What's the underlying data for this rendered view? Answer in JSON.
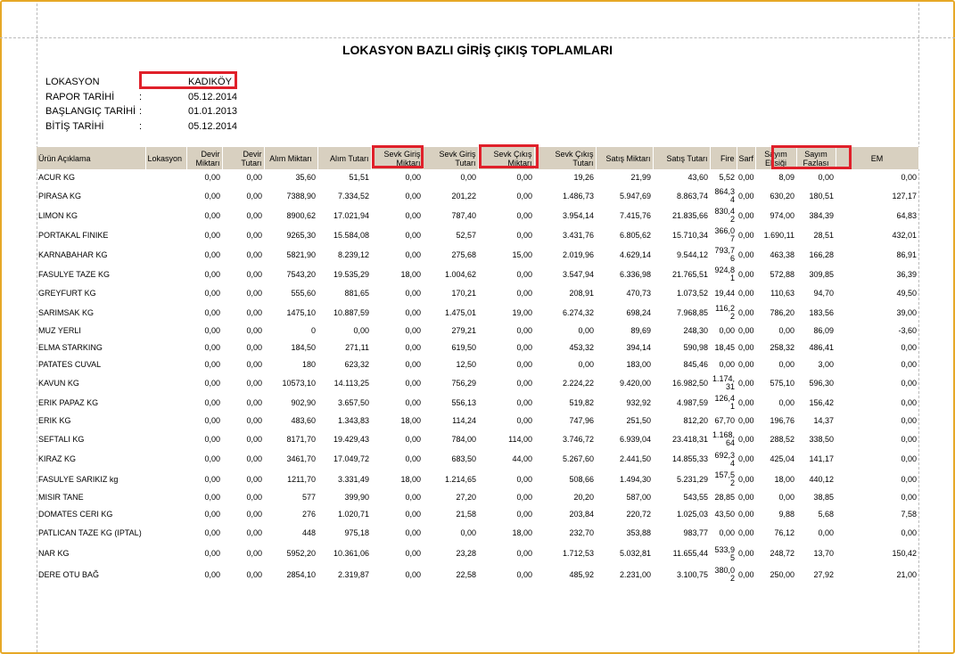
{
  "report": {
    "title": "LOKASYON BAZLI GİRİŞ ÇIKIŞ TOPLAMLARI",
    "meta": [
      {
        "label": "LOKASYON",
        "value": "KADIKÖY"
      },
      {
        "label": "RAPOR TARİHİ",
        "value": "05.12.2014"
      },
      {
        "label": "BAŞLANGIÇ TARİHİ",
        "value": "01.01.2013"
      },
      {
        "label": "BİTİŞ TARİHİ",
        "value": "05.12.2014"
      }
    ]
  },
  "table": {
    "headers": [
      "Ürün Açıklama",
      "Lokasyon",
      "Devir Miktarı",
      "Devir Tutarı",
      "Alım Miktarı",
      "Alım Tutarı",
      "Sevk Giriş Miktarı",
      "Sevk Giriş Tutarı",
      "Sevk Çıkış Miktarı",
      "Sevk Çıkış Tutarı",
      "Satış Miktarı",
      "Satış Tutarı",
      "Fire",
      "Sarf",
      "Sayım Eksiği",
      "Sayım Fazlası",
      "EM"
    ],
    "rows": [
      [
        "ACUR KG",
        "",
        "0,00",
        "0,00",
        "35,60",
        "51,51",
        "0,00",
        "0,00",
        "0,00",
        "19,26",
        "21,99",
        "43,60",
        "5,52",
        "0,00",
        "8,09",
        "0,00",
        "0,00"
      ],
      [
        "PIRASA KG",
        "",
        "0,00",
        "0,00",
        "7388,90",
        "7.334,52",
        "0,00",
        "201,22",
        "0,00",
        "1.486,73",
        "5.947,69",
        "8.863,74",
        "864,34",
        "0,00",
        "630,20",
        "180,51",
        "127,17"
      ],
      [
        "LIMON KG",
        "",
        "0,00",
        "0,00",
        "8900,62",
        "17.021,94",
        "0,00",
        "787,40",
        "0,00",
        "3.954,14",
        "7.415,76",
        "21.835,66",
        "830,42",
        "0,00",
        "974,00",
        "384,39",
        "64,83"
      ],
      [
        "PORTAKAL FINIKE",
        "",
        "0,00",
        "0,00",
        "9265,30",
        "15.584,08",
        "0,00",
        "52,57",
        "0,00",
        "3.431,76",
        "6.805,62",
        "15.710,34",
        "366,07",
        "0,00",
        "1.690,11",
        "28,51",
        "432,01"
      ],
      [
        "KARNABAHAR KG",
        "",
        "0,00",
        "0,00",
        "5821,90",
        "8.239,12",
        "0,00",
        "275,68",
        "15,00",
        "2.019,96",
        "4.629,14",
        "9.544,12",
        "793,76",
        "0,00",
        "463,38",
        "166,28",
        "86,91"
      ],
      [
        "FASULYE TAZE KG",
        "",
        "0,00",
        "0,00",
        "7543,20",
        "19.535,29",
        "18,00",
        "1.004,62",
        "0,00",
        "3.547,94",
        "6.336,98",
        "21.765,51",
        "924,81",
        "0,00",
        "572,88",
        "309,85",
        "36,39"
      ],
      [
        "GREYFURT KG",
        "",
        "0,00",
        "0,00",
        "555,60",
        "881,65",
        "0,00",
        "170,21",
        "0,00",
        "208,91",
        "470,73",
        "1.073,52",
        "19,44",
        "0,00",
        "110,63",
        "94,70",
        "49,50"
      ],
      [
        "SARIMSAK KG",
        "",
        "0,00",
        "0,00",
        "1475,10",
        "10.887,59",
        "0,00",
        "1.475,01",
        "19,00",
        "6.274,32",
        "698,24",
        "7.968,85",
        "116,22",
        "0,00",
        "786,20",
        "183,56",
        "39,00"
      ],
      [
        "MUZ YERLI",
        "",
        "0,00",
        "0,00",
        "0",
        "0,00",
        "0,00",
        "279,21",
        "0,00",
        "0,00",
        "89,69",
        "248,30",
        "0,00",
        "0,00",
        "0,00",
        "86,09",
        "-3,60"
      ],
      [
        "ELMA STARKING",
        "",
        "0,00",
        "0,00",
        "184,50",
        "271,11",
        "0,00",
        "619,50",
        "0,00",
        "453,32",
        "394,14",
        "590,98",
        "18,45",
        "0,00",
        "258,32",
        "486,41",
        "0,00"
      ],
      [
        "PATATES CUVAL",
        "",
        "0,00",
        "0,00",
        "180",
        "623,32",
        "0,00",
        "12,50",
        "0,00",
        "0,00",
        "183,00",
        "845,46",
        "0,00",
        "0,00",
        "0,00",
        "3,00",
        "0,00"
      ],
      [
        "KAVUN KG",
        "",
        "0,00",
        "0,00",
        "10573,10",
        "14.113,25",
        "0,00",
        "756,29",
        "0,00",
        "2.224,22",
        "9.420,00",
        "16.982,50",
        "1.174,31",
        "0,00",
        "575,10",
        "596,30",
        "0,00"
      ],
      [
        "ERIK PAPAZ KG",
        "",
        "0,00",
        "0,00",
        "902,90",
        "3.657,50",
        "0,00",
        "556,13",
        "0,00",
        "519,82",
        "932,92",
        "4.987,59",
        "126,41",
        "0,00",
        "0,00",
        "156,42",
        "0,00"
      ],
      [
        "ERIK KG",
        "",
        "0,00",
        "0,00",
        "483,60",
        "1.343,83",
        "18,00",
        "114,24",
        "0,00",
        "747,96",
        "251,50",
        "812,20",
        "67,70",
        "0,00",
        "196,76",
        "14,37",
        "0,00"
      ],
      [
        "SEFTALI KG",
        "",
        "0,00",
        "0,00",
        "8171,70",
        "19.429,43",
        "0,00",
        "784,00",
        "114,00",
        "3.746,72",
        "6.939,04",
        "23.418,31",
        "1.168,64",
        "0,00",
        "288,52",
        "338,50",
        "0,00"
      ],
      [
        "KIRAZ KG",
        "",
        "0,00",
        "0,00",
        "3461,70",
        "17.049,72",
        "0,00",
        "683,50",
        "44,00",
        "5.267,60",
        "2.441,50",
        "14.855,33",
        "692,34",
        "0,00",
        "425,04",
        "141,17",
        "0,00"
      ],
      [
        "FASULYE SARIKIZ kg",
        "",
        "0,00",
        "0,00",
        "1211,70",
        "3.331,49",
        "18,00",
        "1.214,65",
        "0,00",
        "508,66",
        "1.494,30",
        "5.231,29",
        "157,52",
        "0,00",
        "18,00",
        "440,12",
        "0,00"
      ],
      [
        "MISIR TANE",
        "",
        "0,00",
        "0,00",
        "577",
        "399,90",
        "0,00",
        "27,20",
        "0,00",
        "20,20",
        "587,00",
        "543,55",
        "28,85",
        "0,00",
        "0,00",
        "38,85",
        "0,00"
      ],
      [
        "DOMATES CERI KG",
        "",
        "0,00",
        "0,00",
        "276",
        "1.020,71",
        "0,00",
        "21,58",
        "0,00",
        "203,84",
        "220,72",
        "1.025,03",
        "43,50",
        "0,00",
        "9,88",
        "5,68",
        "7,58"
      ],
      [
        "PATLICAN TAZE KG (IPTAL)",
        "",
        "0,00",
        "0,00",
        "448",
        "975,18",
        "0,00",
        "0,00",
        "18,00",
        "232,70",
        "353,88",
        "983,77",
        "0,00",
        "0,00",
        "76,12",
        "0,00",
        "0,00"
      ],
      [
        "NAR KG",
        "",
        "0,00",
        "0,00",
        "5952,20",
        "10.361,06",
        "0,00",
        "23,28",
        "0,00",
        "1.712,53",
        "5.032,81",
        "11.655,44",
        "533,95",
        "0,00",
        "248,72",
        "13,70",
        "150,42"
      ],
      [
        "DERE OTU BAĞ",
        "",
        "0,00",
        "0,00",
        "2854,10",
        "2.319,87",
        "0,00",
        "22,58",
        "0,00",
        "485,92",
        "2.231,00",
        "3.100,75",
        "380,02",
        "0,00",
        "250,00",
        "27,92",
        "21,00"
      ]
    ]
  }
}
